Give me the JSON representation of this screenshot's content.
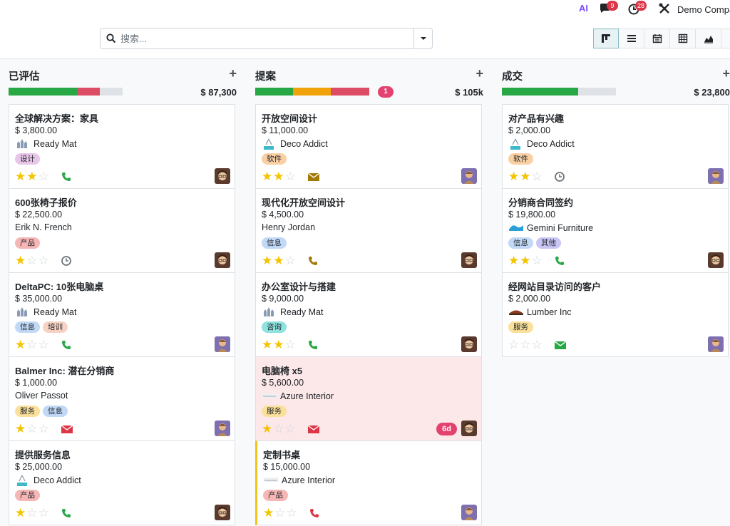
{
  "topbar": {
    "ai_label": "AI",
    "chat_badge": "9",
    "activity_badge": "28",
    "company": "Demo Compa"
  },
  "search": {
    "placeholder": "搜索..."
  },
  "views": [
    "kanban-icon",
    "list-icon",
    "calendar-icon",
    "pivot-icon",
    "graph-icon",
    "map-icon"
  ],
  "columns": [
    {
      "title": "已评估",
      "total": "$ 87,300",
      "progress": [
        {
          "color": "#28a745",
          "pct": 60
        },
        {
          "color": "#dc4c64",
          "pct": 20
        }
      ],
      "badge": "",
      "cards": [
        {
          "title": "全球解决方案：家具",
          "amount": "$ 3,800.00",
          "partner": "Ready Mat",
          "logo": "readymat",
          "tags": [
            {
              "label": "设计",
              "color": "#e7c6e8"
            }
          ],
          "stars": 2,
          "activity": "phone-icon",
          "activity_color": "#28a745",
          "avatar": "mitchell"
        },
        {
          "title": "600张椅子报价",
          "amount": "$ 22,500.00",
          "partner": "Erik N. French",
          "logo": "",
          "tags": [
            {
              "label": "产品",
              "color": "#f7b6b6"
            }
          ],
          "stars": 1,
          "activity": "clock-icon",
          "activity_color": "#6c757d",
          "avatar": "mitchell"
        },
        {
          "title": "DeltaPC: 10张电脑桌",
          "amount": "$ 35,000.00",
          "partner": "Ready Mat",
          "logo": "readymat",
          "tags": [
            {
              "label": "信息",
              "color": "#c1d9f7"
            },
            {
              "label": "培训",
              "color": "#f9d2c6"
            }
          ],
          "stars": 1,
          "activity": "phone-icon",
          "activity_color": "#28a745",
          "avatar": "marc"
        },
        {
          "title": "Balmer Inc: 潜在分销商",
          "amount": "$ 1,000.00",
          "partner": "Oliver Passot",
          "logo": "",
          "tags": [
            {
              "label": "服务",
              "color": "#fbe09a"
            },
            {
              "label": "信息",
              "color": "#c1d9f7"
            }
          ],
          "stars": 1,
          "activity": "envelope-icon",
          "activity_color": "#dc3545",
          "avatar": "marc"
        },
        {
          "title": "提供服务信息",
          "amount": "$ 25,000.00",
          "partner": "Deco Addict",
          "logo": "deco",
          "tags": [
            {
              "label": "产品",
              "color": "#f7b6b6"
            }
          ],
          "stars": 1,
          "activity": "phone-icon",
          "activity_color": "#28a745",
          "avatar": "mitchell"
        }
      ]
    },
    {
      "title": "提案",
      "total": "$ 105k",
      "progress": [
        {
          "color": "#28a745",
          "pct": 33
        },
        {
          "color": "#f0a30a",
          "pct": 33
        },
        {
          "color": "#dc4c64",
          "pct": 34
        }
      ],
      "badge": "1",
      "cards": [
        {
          "title": "开放空间设计",
          "amount": "$ 11,000.00",
          "partner": "Deco Addict",
          "logo": "deco",
          "tags": [
            {
              "label": "软件",
              "color": "#f9cfa3"
            }
          ],
          "stars": 2,
          "activity": "envelope-icon",
          "activity_color": "#a27a07",
          "avatar": "marc"
        },
        {
          "title": "现代化开放空间设计",
          "amount": "$ 4,500.00",
          "partner": "Henry Jordan",
          "logo": "",
          "tags": [
            {
              "label": "信息",
              "color": "#c1d9f7"
            }
          ],
          "stars": 2,
          "activity": "phone-icon",
          "activity_color": "#a27a07",
          "avatar": "mitchell"
        },
        {
          "title": "办公室设计与搭建",
          "amount": "$ 9,000.00",
          "partner": "Ready Mat",
          "logo": "readymat",
          "tags": [
            {
              "label": "咨询",
              "color": "#8ee3de"
            }
          ],
          "stars": 2,
          "activity": "phone-icon",
          "activity_color": "#28a745",
          "avatar": "mitchell"
        },
        {
          "title": "电脑椅 x5",
          "amount": "$ 5,600.00",
          "partner": "Azure Interior",
          "logo": "azure",
          "tags": [
            {
              "label": "服务",
              "color": "#fbe09a"
            }
          ],
          "stars": 1,
          "activity": "envelope-icon",
          "activity_color": "#dc3545",
          "avatar": "mitchell",
          "overdue": "6d"
        },
        {
          "title": "定制书桌",
          "amount": "$ 15,000.00",
          "partner": "Azure Interior",
          "logo": "azure",
          "tags": [
            {
              "label": "产品",
              "color": "#f7b6b6"
            }
          ],
          "stars": 1,
          "activity": "phone-icon",
          "activity_color": "#dc3545",
          "avatar": "marc",
          "warn": true
        }
      ]
    },
    {
      "title": "成交",
      "total": "$ 23,800",
      "progress": [
        {
          "color": "#28a745",
          "pct": 67
        }
      ],
      "badge": "",
      "cards": [
        {
          "title": "对产品有兴趣",
          "amount": "$ 2,000.00",
          "partner": "Deco Addict",
          "logo": "deco",
          "tags": [
            {
              "label": "软件",
              "color": "#f9cfa3"
            }
          ],
          "stars": 2,
          "activity": "clock-icon",
          "activity_color": "#6c757d",
          "avatar": "marc"
        },
        {
          "title": "分销商合同签约",
          "amount": "$ 19,800.00",
          "partner": "Gemini Furniture",
          "logo": "gemini",
          "tags": [
            {
              "label": "信息",
              "color": "#c1d9f7"
            },
            {
              "label": "其他",
              "color": "#c9c5f5"
            }
          ],
          "stars": 2,
          "activity": "phone-icon",
          "activity_color": "#28a745",
          "avatar": "mitchell"
        },
        {
          "title": "经网站目录访问的客户",
          "amount": "$ 2,000.00",
          "partner": "Lumber Inc",
          "logo": "lumber",
          "tags": [
            {
              "label": "服务",
              "color": "#fbe09a"
            }
          ],
          "stars": 0,
          "activity": "envelope-icon",
          "activity_color": "#28a745",
          "avatar": "marc"
        }
      ]
    }
  ]
}
